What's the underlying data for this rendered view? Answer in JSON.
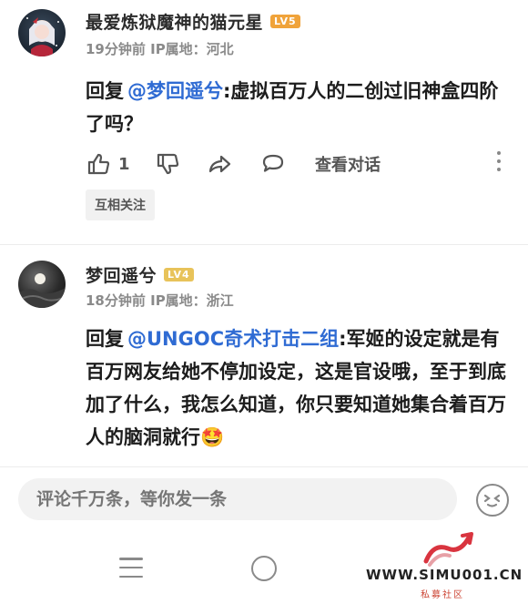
{
  "comments": [
    {
      "username": "最爱炼狱魔神的猫元星",
      "level": "LV5",
      "level_color": "#f0a33a",
      "time": "19分钟前",
      "location": "IP属地：河北",
      "reply_prefix": "回复",
      "mention": "@梦回遥兮",
      "text": ":虚拟百万人的二创过旧神盒四阶了吗？",
      "like_count": "1",
      "view_dialog": "查看对话",
      "tag": "互相关注"
    },
    {
      "username": "梦回遥兮",
      "level": "LV4",
      "level_color": "#e8c35a",
      "time": "18分钟前",
      "location": "IP属地：浙江",
      "reply_prefix": "回复",
      "mention": "@UNGOC奇术打击二组",
      "text": ":军姬的设定就是有百万网友给她不停加设定，这是官设哦，至于到底加了什么，我怎么知道，你只要知道她集合着百万人的脑洞就行",
      "emoji": "🤩"
    }
  ],
  "input": {
    "placeholder": "评论千万条，等你发一条"
  },
  "watermark": {
    "url": "WWW.SIMU001.CN",
    "sub": "私募社区"
  },
  "colors": {
    "mention": "#2f6bd3",
    "meta": "#8a8a8a"
  }
}
